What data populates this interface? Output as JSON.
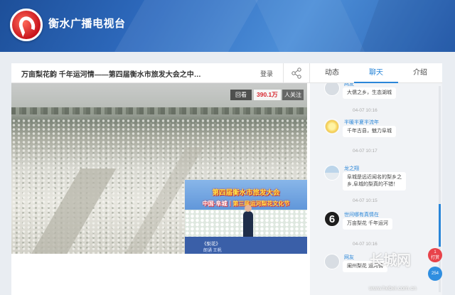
{
  "header": {
    "site_title": "衡水广播电视台",
    "logo_icon": "hengshui-tv-logo-icon",
    "bg_color": "#2f6cc0"
  },
  "player": {
    "video_title": "万亩梨花韵 千年运河情——第四届衡水市旅发大会之中…",
    "login_label": "登录",
    "share_icon": "share-icon",
    "replay_label": "回看",
    "viewer_count": "390.1万",
    "viewer_label": "人关注",
    "inset": {
      "banner_line1": "第四届衡水市旅发大会",
      "banner_line2_prefix": "中国·阜城",
      "banner_line2_highlight": "第三届运河梨花文化节",
      "caption1": "《梨花》",
      "caption2": "朗诵    王帆"
    }
  },
  "tabs": [
    {
      "label": "动态",
      "active": false
    },
    {
      "label": "聊天",
      "active": true
    },
    {
      "label": "介绍",
      "active": false
    }
  ],
  "chat": {
    "messages": [
      {
        "nick": "网友",
        "text": "大儒之乡，生态湖城",
        "avatar": "default-avatar-icon",
        "time": "04-07 10:16"
      },
      {
        "nick": "半暖半夏半流年",
        "text": "千年古县，魅力阜城",
        "avatar": "sun-avatar-icon",
        "time": "04-07 10:17"
      },
      {
        "nick": "龙之翔",
        "text": "阜城是远近闻名的梨乡之",
        "text2": "乡,阜城的梨真的不错！",
        "avatar": "landscape-avatar-icon",
        "time": "04-07 10:15"
      },
      {
        "nick": "世间哪有真情在",
        "text": "万亩梨花 千年运河",
        "avatar": "number-six-avatar-icon",
        "time": "04-07 10:16"
      },
      {
        "nick": "网友",
        "text": "阑州梨花 运河情",
        "avatar": "default-avatar-icon"
      }
    ],
    "reward_label": "打赏",
    "reward_count": "1",
    "like_label": "点赞",
    "like_count": "254"
  },
  "watermark": {
    "brand": "长城网",
    "url": "www.hebei.com.cn"
  },
  "colors": {
    "accent": "#2a86d8",
    "viewer_red": "#d8262e"
  }
}
